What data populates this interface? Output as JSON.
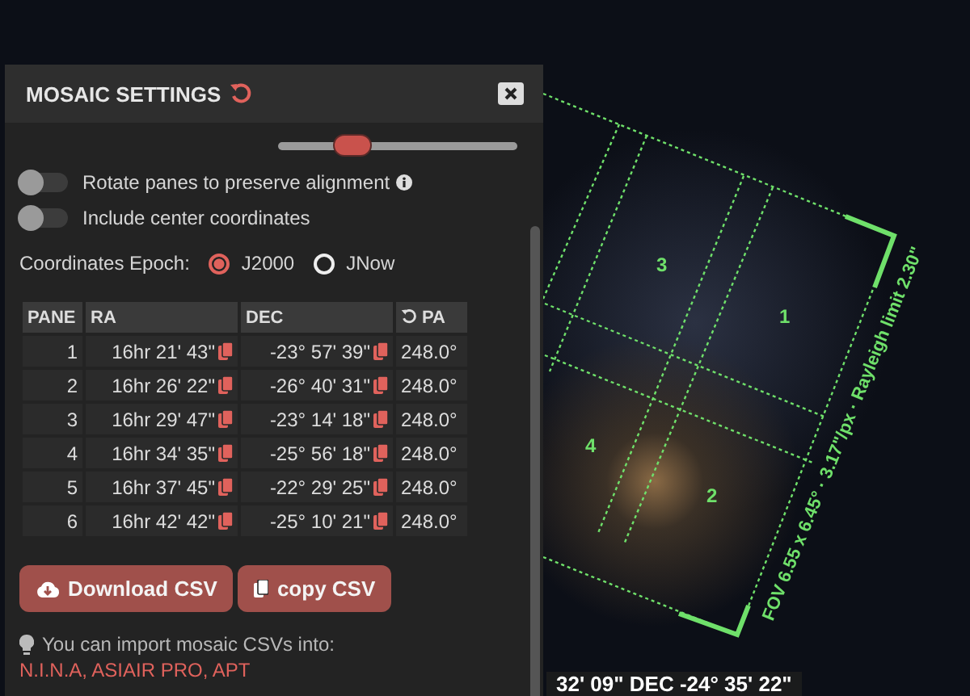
{
  "panel": {
    "title": "MOSAIC SETTINGS",
    "slider": {
      "level": 0.32
    },
    "toggles": [
      {
        "kind": "info",
        "label": "Rotate panes to preserve alignment",
        "on": false
      },
      {
        "kind": "plain",
        "label": "Include center coordinates",
        "on": false
      }
    ],
    "epoch": {
      "label": "Coordinates Epoch:",
      "options": [
        {
          "label": "J2000",
          "selected": true
        },
        {
          "label": "JNow",
          "selected": false
        }
      ]
    },
    "table": {
      "columns": [
        "PANE",
        "RA",
        "DEC",
        "PA"
      ],
      "rows": [
        [
          "1",
          "16hr 21' 43\"",
          "-23° 57' 39\"",
          "248.0°"
        ],
        [
          "2",
          "16hr 26' 22\"",
          "-26° 40' 31\"",
          "248.0°"
        ],
        [
          "3",
          "16hr 29' 47\"",
          "-23° 14' 18\"",
          "248.0°"
        ],
        [
          "4",
          "16hr 34' 35\"",
          "-25° 56' 18\"",
          "248.0°"
        ],
        [
          "5",
          "16hr 37' 45\"",
          "-22° 29' 25\"",
          "248.0°"
        ],
        [
          "6",
          "16hr 42' 42\"",
          "-25° 10' 21\"",
          "248.0°"
        ]
      ]
    },
    "buttons": [
      {
        "kind": "download",
        "label": "Download CSV"
      },
      {
        "kind": "copy",
        "label": "copy CSV"
      }
    ],
    "tip": "You can import mosaic CSVs into:",
    "link": "N.I.N.A, ASIAIR PRO, APT"
  },
  "sky": {
    "pane_labels": [
      "3",
      "1",
      "4",
      "2"
    ],
    "fov": "FOV 6.55 x 6.45° · 3.17\"/px · Rayleigh limit 2.30\"",
    "status": "32' 09\"  DEC -24° 35' 22\""
  }
}
